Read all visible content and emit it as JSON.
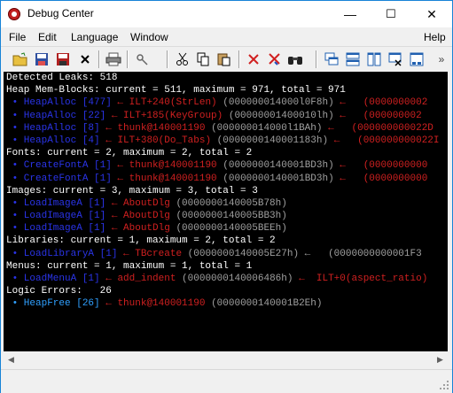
{
  "window": {
    "title": "Debug Center",
    "minimize": "—",
    "maximize": "☐",
    "close": "✕"
  },
  "menu": {
    "file": "File",
    "edit": "Edit",
    "language": "Language",
    "window": "Window",
    "help": "Help"
  },
  "toolbar": {
    "overflow": "»"
  },
  "console": {
    "detected": "Detected Leaks: 518",
    "heap_header": "Heap Mem-Blocks: current = 511, maximum = 971, total = 971",
    "heap_rows": [
      {
        "fn": " • HeapAlloc [477]",
        "arrow": " ← ",
        "target": "ILT+240(StrLen)",
        "addr": " (000000014000l0F8h) ",
        "more": "←   (0000000002"
      },
      {
        "fn": " • HeapAlloc [22]",
        "arrow": " ← ",
        "target": "ILT+185(KeyGroup)",
        "addr": " (00000001400010lh) ",
        "more": "←   (000000002"
      },
      {
        "fn": " • HeapAlloc [8]",
        "arrow": " ← ",
        "target": "thunk@140001190",
        "addr": " (000000014000l1BAh) ",
        "more": "←   (000000000022D"
      },
      {
        "fn": " • HeapAlloc [4]",
        "arrow": " ← ",
        "target": "ILT+380(Do_Tabs)",
        "addr": " (0000000140001183h) ",
        "more": "←   (000000000022I"
      }
    ],
    "fonts_header": "Fonts: current = 2, maximum = 2, total = 2",
    "font_rows": [
      {
        "fn": " • CreateFontA [1]",
        "arrow": " ← ",
        "target": "thunk@140001190",
        "addr": " (0000000140001BD3h) ",
        "more": "←   (0000000000"
      },
      {
        "fn": " • CreateFontA [1]",
        "arrow": " ← ",
        "target": "thunk@140001190",
        "addr": " (0000000140001BD3h) ",
        "more": "←   (0000000000"
      }
    ],
    "images_header": "Images: current = 3, maximum = 3, total = 3",
    "image_rows": [
      {
        "fn": " • LoadImageA [1]",
        "arrow": " ← ",
        "target": "AboutDlg",
        "addr": " (0000000140005B78h)",
        "more": ""
      },
      {
        "fn": " • LoadImageA [1]",
        "arrow": " ← ",
        "target": "AboutDlg",
        "addr": " (0000000140005BB3h)",
        "more": ""
      },
      {
        "fn": " • LoadImageA [1]",
        "arrow": " ← ",
        "target": "AboutDlg",
        "addr": " (0000000140005BEEh)",
        "more": ""
      }
    ],
    "libraries_header": "Libraries: current = 1, maximum = 2, total = 2",
    "library_rows": [
      {
        "fn": " • LoadLibraryA [1]",
        "arrow": " ← ",
        "target": "TBcreate",
        "addr": " (0000000140005E27h) ",
        "more": "←   (0000000000001F3"
      }
    ],
    "menus_header": "Menus: current = 1, maximum = 1, total = 1",
    "menu_rows": [
      {
        "fn": " • LoadMenuA [1]",
        "arrow": " ← ",
        "target": "add_indent",
        "addr": " (0000000140006486h) ",
        "more": "←  ILT+0(aspect_ratio)"
      }
    ],
    "logic_header": "Logic Errors:   26",
    "logic_rows": [
      {
        "fn": " • HeapFree [26]",
        "arrow": " ← ",
        "target": "thunk@140001190",
        "addr": " (0000000140001B2Eh)",
        "more": ""
      }
    ]
  },
  "scroll": {
    "left": "◀",
    "right": "▶"
  }
}
